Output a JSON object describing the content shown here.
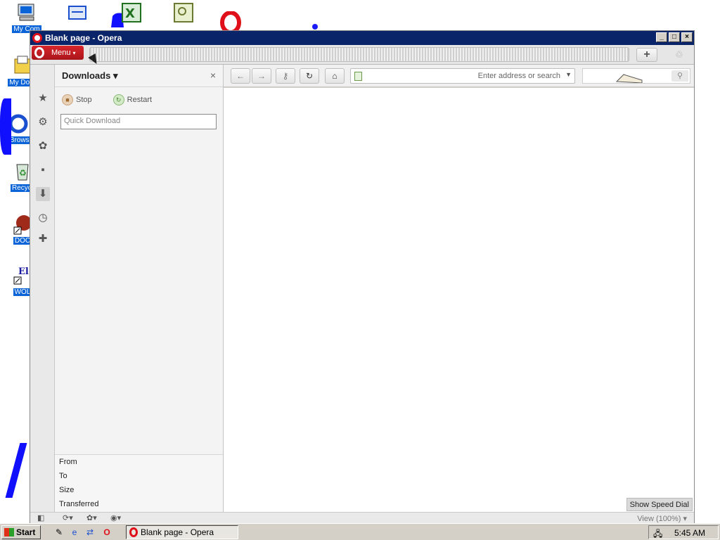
{
  "desktop": {
    "icons": [
      {
        "label": "My Com",
        "icon": "my-computer-icon"
      },
      {
        "label": "My Docu",
        "icon": "my-documents-icon"
      },
      {
        "label": "(Brows",
        "icon": "internet-explorer-icon"
      },
      {
        "label": "Recycl",
        "icon": "recycle-bin-icon"
      },
      {
        "label": "DOC",
        "icon": "doc-shortcut-icon"
      },
      {
        "label": "WOL",
        "icon": "wol-shortcut-icon"
      }
    ],
    "top_icons": [
      "network-sync-icon",
      "excel-shortcut-icon",
      "project-shortcut-icon",
      "opera-icon"
    ]
  },
  "window": {
    "title": "Blank page - Opera",
    "controls": {
      "minimize": "_",
      "maximize": "□",
      "close": "×"
    }
  },
  "tabbar": {
    "menu_label": "Menu",
    "new_tab_label": "+",
    "trash_icon": "trash-icon"
  },
  "panel_bar": {
    "items": [
      {
        "name": "bookmarks",
        "icon": "★"
      },
      {
        "name": "widgets",
        "icon": "⚙"
      },
      {
        "name": "unite",
        "icon": "✿"
      },
      {
        "name": "notes",
        "icon": "▪"
      },
      {
        "name": "downloads",
        "icon": "⬇"
      },
      {
        "name": "history",
        "icon": "◷"
      },
      {
        "name": "add-panel",
        "icon": "✚"
      }
    ]
  },
  "downloads_panel": {
    "title": "Downloads ▾",
    "close": "×",
    "stop_label": "Stop",
    "restart_label": "Restart",
    "quick_download_placeholder": "Quick Download",
    "info": {
      "from": "From",
      "to": "To",
      "size": "Size",
      "transferred": "Transferred"
    }
  },
  "nav": {
    "back": "←",
    "forward": "→",
    "wand": "⚷",
    "reload": "↻",
    "home": "⌂",
    "address_placeholder": "Enter address or search",
    "search_button": "⚲"
  },
  "status": {
    "speed_dial": "Show Speed Dial",
    "zoom": "View (100%) ▾"
  },
  "taskbar": {
    "start": "Start",
    "task_title": "Blank page - Opera",
    "clock": "5:45 AM"
  }
}
